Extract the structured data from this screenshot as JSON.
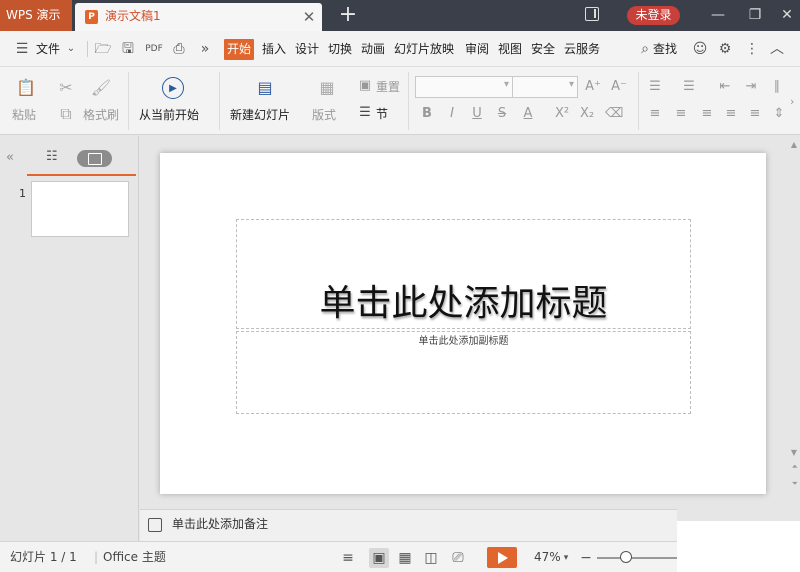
{
  "titlebar": {
    "app_name": "WPS 演示",
    "doc_title": "演示文稿1",
    "doc_icon_letter": "P",
    "login_label": "未登录"
  },
  "menubar": {
    "file_label": "文件",
    "tabs": [
      "开始",
      "插入",
      "设计",
      "切换",
      "动画",
      "幻灯片放映",
      "审阅",
      "视图",
      "安全",
      "云服务"
    ],
    "active_tab": "开始",
    "search_label": "查找"
  },
  "ribbon": {
    "paste_label": "粘贴",
    "format_painter_label": "格式刷",
    "from_current_label": "从当前开始",
    "new_slide_label": "新建幻灯片",
    "layout_label": "版式",
    "reset_label": "重置",
    "section_label": "节"
  },
  "panel": {
    "slide_number": "1"
  },
  "slide": {
    "title_placeholder": "单击此处添加标题",
    "subtitle_placeholder": "单击此处添加副标题"
  },
  "notes": {
    "placeholder": "单击此处添加备注"
  },
  "statusbar": {
    "slide_info": "幻灯片 1 / 1",
    "theme_label": "Office 主题",
    "zoom": "47%"
  },
  "colors": {
    "accent": "#e0662e",
    "titlebar_bg": "#3b3f4a",
    "login_bg": "#c8403a"
  }
}
